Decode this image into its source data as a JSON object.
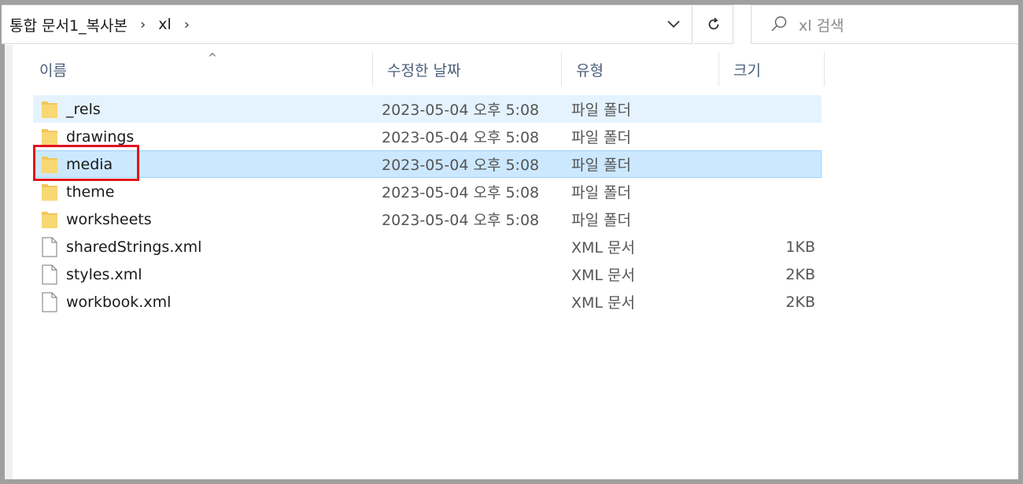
{
  "address": {
    "crumbs": [
      "통합 문서1_복사본",
      "xl"
    ],
    "separator": "›"
  },
  "search": {
    "placeholder": "xl 검색"
  },
  "columns": {
    "name": "이름",
    "date": "수정한 날짜",
    "type": "유형",
    "size": "크기"
  },
  "files": [
    {
      "name": "_rels",
      "date": "2023-05-04 오후 5:08",
      "type": "파일 폴더",
      "size": "",
      "kind": "folder",
      "state": "hover"
    },
    {
      "name": "drawings",
      "date": "2023-05-04 오후 5:08",
      "type": "파일 폴더",
      "size": "",
      "kind": "folder",
      "state": ""
    },
    {
      "name": "media",
      "date": "2023-05-04 오후 5:08",
      "type": "파일 폴더",
      "size": "",
      "kind": "folder",
      "state": "selected"
    },
    {
      "name": "theme",
      "date": "2023-05-04 오후 5:08",
      "type": "파일 폴더",
      "size": "",
      "kind": "folder",
      "state": ""
    },
    {
      "name": "worksheets",
      "date": "2023-05-04 오후 5:08",
      "type": "파일 폴더",
      "size": "",
      "kind": "folder",
      "state": ""
    },
    {
      "name": "sharedStrings.xml",
      "date": "",
      "type": "XML 문서",
      "size": "1KB",
      "kind": "file",
      "state": ""
    },
    {
      "name": "styles.xml",
      "date": "",
      "type": "XML 문서",
      "size": "2KB",
      "kind": "file",
      "state": ""
    },
    {
      "name": "workbook.xml",
      "date": "",
      "type": "XML 문서",
      "size": "2KB",
      "kind": "file",
      "state": ""
    }
  ],
  "colors": {
    "hover": "#e5f3ff",
    "selected": "#cce8ff",
    "highlight": "#e0141e",
    "folder": "#f8d775"
  }
}
